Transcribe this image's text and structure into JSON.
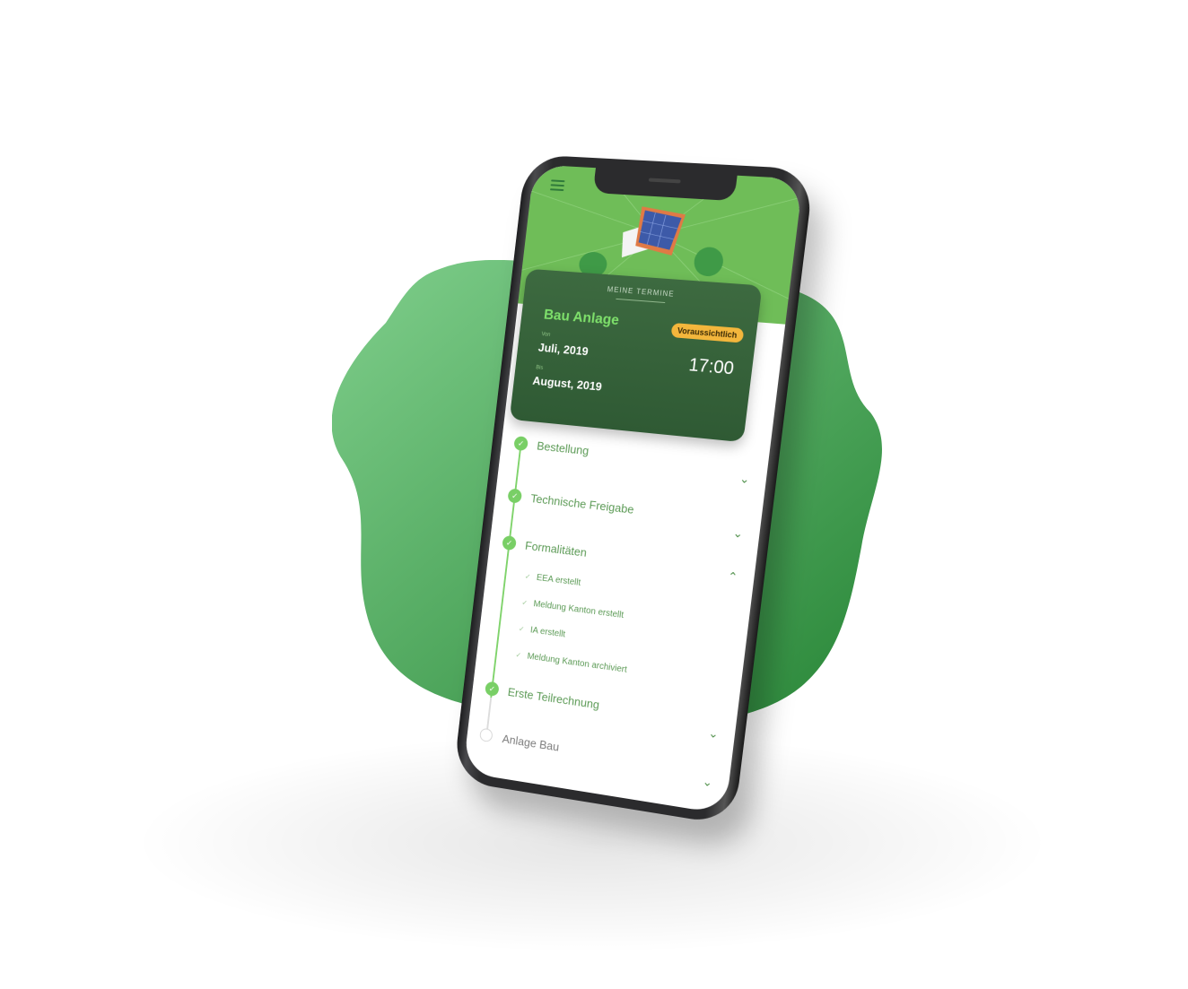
{
  "card": {
    "heading": "MEINE TERMINE",
    "title": "Bau Anlage",
    "badge": "Voraussichtlich",
    "from_label": "Von",
    "from_value": "Juli, 2019",
    "to_label": "Bis",
    "to_value": "August, 2019",
    "time": "17:00"
  },
  "steps": [
    {
      "label": "Bestellung",
      "done": true,
      "expanded": false
    },
    {
      "label": "Technische Freigabe",
      "done": true,
      "expanded": false
    },
    {
      "label": "Formalitäten",
      "done": true,
      "expanded": true
    },
    {
      "label": "Erste Teilrechnung",
      "done": true,
      "expanded": false
    },
    {
      "label": "Anlage Bau",
      "done": false,
      "expanded": false
    }
  ],
  "substeps": [
    {
      "label": "EEA erstellt"
    },
    {
      "label": "Meldung Kanton erstellt"
    },
    {
      "label": "IA erstellt"
    },
    {
      "label": "Meldung Kanton archiviert"
    }
  ],
  "colors": {
    "accent": "#79cf66",
    "card_bg": "#2f5a34",
    "badge": "#f3b63c",
    "blob_light": "#7ccb8a",
    "blob_dark": "#2e8a3c"
  },
  "icons": {
    "menu": "hamburger-menu-icon",
    "done": "check-icon",
    "collapsed": "chevron-down-icon",
    "expanded": "chevron-up-icon"
  }
}
